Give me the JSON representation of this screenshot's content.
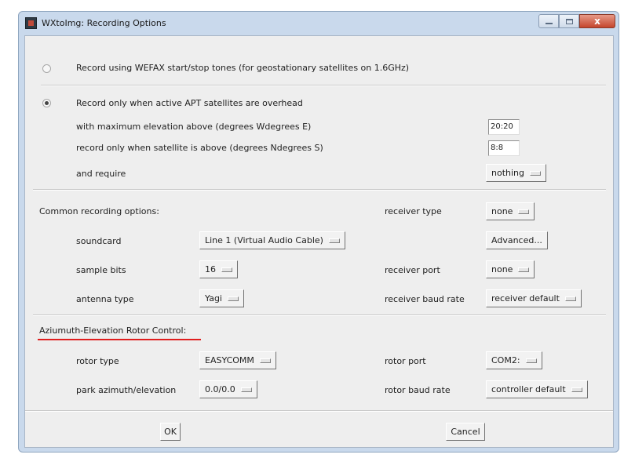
{
  "window": {
    "title": "WXtoImg: Recording Options"
  },
  "record_mode": {
    "option1_label": "Record using WEFAX start/stop tones (for geostationary satellites on 1.6GHz)",
    "option2_label": "Record only when active APT satellites are overhead",
    "selected": "option2"
  },
  "apt": {
    "max_elev_label": "with maximum elevation above (degrees Wdegrees E)",
    "max_elev_value": "20:20",
    "above_label": "record only when satellite is above (degrees Ndegrees S)",
    "above_value": "8:8",
    "require_label": "and require",
    "require_value": "nothing"
  },
  "common": {
    "section_label": "Common recording options:",
    "soundcard_label": "soundcard",
    "soundcard_value": "Line 1 (Virtual Audio Cable)",
    "sample_bits_label": "sample bits",
    "sample_bits_value": "16",
    "antenna_label": "antenna type",
    "antenna_value": "Yagi",
    "receiver_type_label": "receiver type",
    "receiver_type_value": "none",
    "advanced_label": "Advanced...",
    "receiver_port_label": "receiver port",
    "receiver_port_value": "none",
    "receiver_baud_label": "receiver baud rate",
    "receiver_baud_value": "receiver default"
  },
  "rotor": {
    "section_label": "Aziumuth-Elevation Rotor Control:",
    "type_label": "rotor type",
    "type_value": "EASYCOMM",
    "park_label": "park azimuth/elevation",
    "park_value": "0.0/0.0",
    "port_label": "rotor port",
    "port_value": "COM2:",
    "baud_label": "rotor baud rate",
    "baud_value": "controller default"
  },
  "buttons": {
    "ok": "OK",
    "cancel": "Cancel"
  },
  "window_controls": {
    "close_glyph": "x"
  },
  "colors": {
    "highlight_underline": "#e01e1e"
  }
}
